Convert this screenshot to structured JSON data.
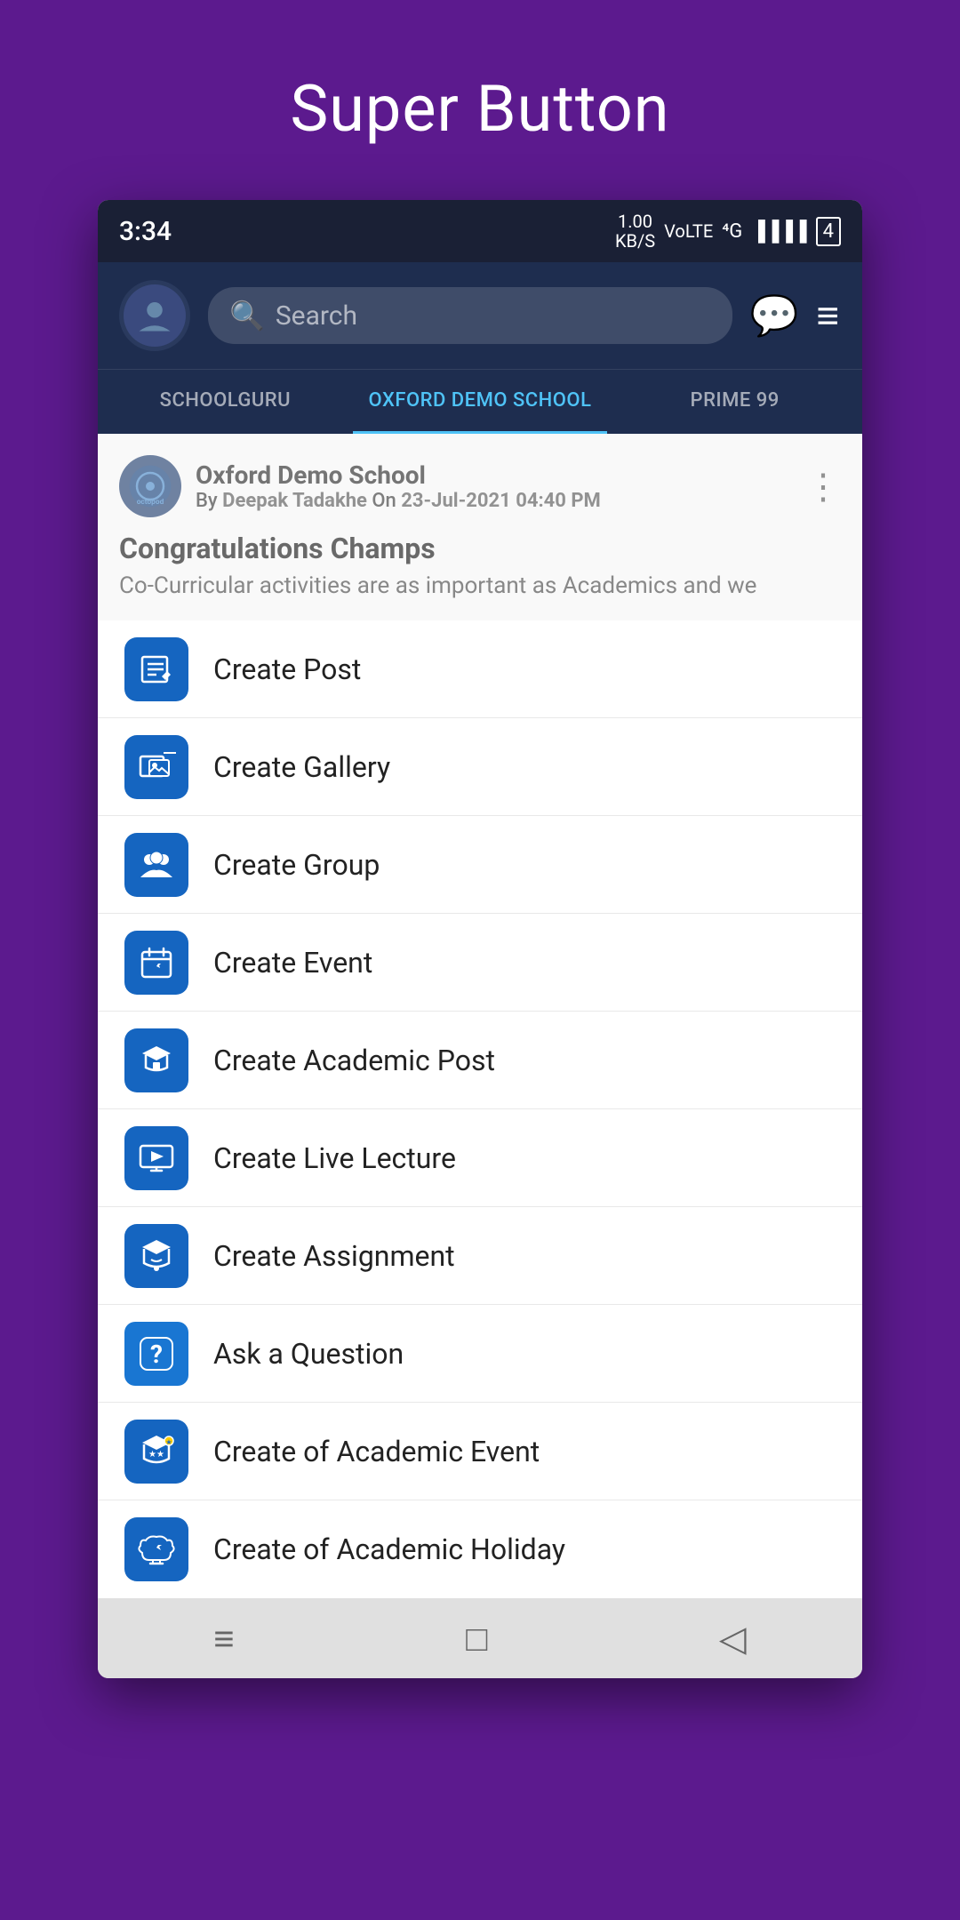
{
  "page": {
    "title": "Super Button"
  },
  "statusBar": {
    "time": "3:34",
    "network": "1.00 KB/S",
    "networkType": "VoLTE",
    "signal": "4G",
    "battery": "4"
  },
  "header": {
    "searchPlaceholder": "Search"
  },
  "tabs": [
    {
      "label": "SCHOOLGURU",
      "active": false
    },
    {
      "label": "OXFORD DEMO SCHOOL",
      "active": true
    },
    {
      "label": "PRIME 99",
      "active": false
    }
  ],
  "post": {
    "schoolName": "Oxford Demo School",
    "author": "Deepak Tadakhe",
    "date": "23-Jul-2021 04:40 PM",
    "prefix": "By",
    "onText": "On",
    "title": "Congratulations Champs",
    "excerpt": "Co-Curricular activities are as important as Academics and we"
  },
  "menuItems": [
    {
      "id": "create-post",
      "label": "Create Post",
      "icon": "post"
    },
    {
      "id": "create-gallery",
      "label": "Create Gallery",
      "icon": "gallery"
    },
    {
      "id": "create-group",
      "label": "Create Group",
      "icon": "group"
    },
    {
      "id": "create-event",
      "label": "Create Event",
      "icon": "event"
    },
    {
      "id": "create-academic-post",
      "label": "Create Academic Post",
      "icon": "academic-post"
    },
    {
      "id": "create-live-lecture",
      "label": "Create Live Lecture",
      "icon": "live-lecture"
    },
    {
      "id": "create-assignment",
      "label": "Create Assignment",
      "icon": "assignment"
    },
    {
      "id": "ask-question",
      "label": "Ask a Question",
      "icon": "question"
    },
    {
      "id": "create-academic-event",
      "label": "Create of Academic Event",
      "icon": "academic-event"
    },
    {
      "id": "create-academic-holiday",
      "label": "Create of Academic Holiday",
      "icon": "academic-holiday"
    }
  ],
  "bottomNav": {
    "menuIcon": "≡",
    "homeIcon": "□",
    "backIcon": "◁"
  }
}
